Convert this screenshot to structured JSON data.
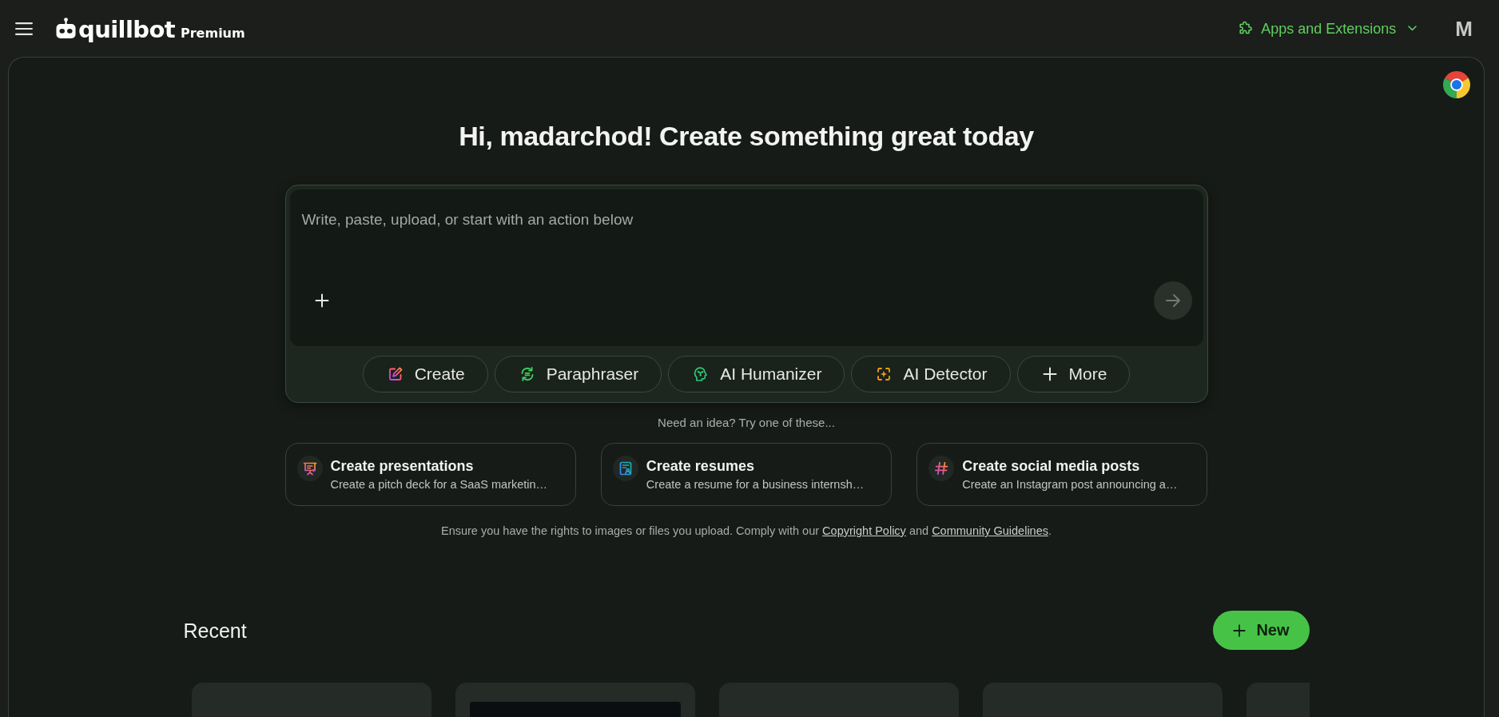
{
  "header": {
    "brand": "quillbot",
    "plan": "Premium",
    "apps_menu": {
      "label": "Apps and Extensions",
      "expanded": false
    },
    "avatar": "M"
  },
  "greeting": "Hi, madarchod! Create something great today",
  "composer": {
    "placeholder": "Write, paste, upload, or start with an action below",
    "send_button": {
      "disabled": true
    },
    "actions": [
      {
        "kind": "create",
        "label": "Create"
      },
      {
        "kind": "paraphraser",
        "label": "Paraphraser"
      },
      {
        "kind": "humanizer",
        "label": "AI Humanizer"
      },
      {
        "kind": "detector",
        "label": "AI Detector"
      },
      {
        "kind": "more",
        "label": "More"
      }
    ]
  },
  "ideas": {
    "prompt": "Need an idea? Try one of these...",
    "cards": [
      {
        "kind": "presentation",
        "title": "Create presentations",
        "description": "Create a pitch deck for a SaaS marketin…"
      },
      {
        "kind": "resume",
        "title": "Create resumes",
        "description": "Create a resume for a business internsh…"
      },
      {
        "kind": "social",
        "title": "Create social media posts",
        "description": "Create an Instagram post announcing a…"
      }
    ]
  },
  "disclaimer": [
    {
      "kind": "text",
      "text": "Ensure you have the rights to images or files you upload. Comply with our "
    },
    {
      "kind": "link",
      "text": "Copyright Policy"
    },
    {
      "kind": "text",
      "text": " and "
    },
    {
      "kind": "link",
      "text": "Community Guidelines"
    },
    {
      "kind": "text",
      "text": "."
    }
  ],
  "recent": {
    "title": "Recent",
    "new_button": "New",
    "items": [
      {
        "kind": "document"
      },
      {
        "kind": "image"
      },
      {
        "kind": "document"
      },
      {
        "kind": "document"
      },
      {
        "kind": "document"
      }
    ]
  }
}
